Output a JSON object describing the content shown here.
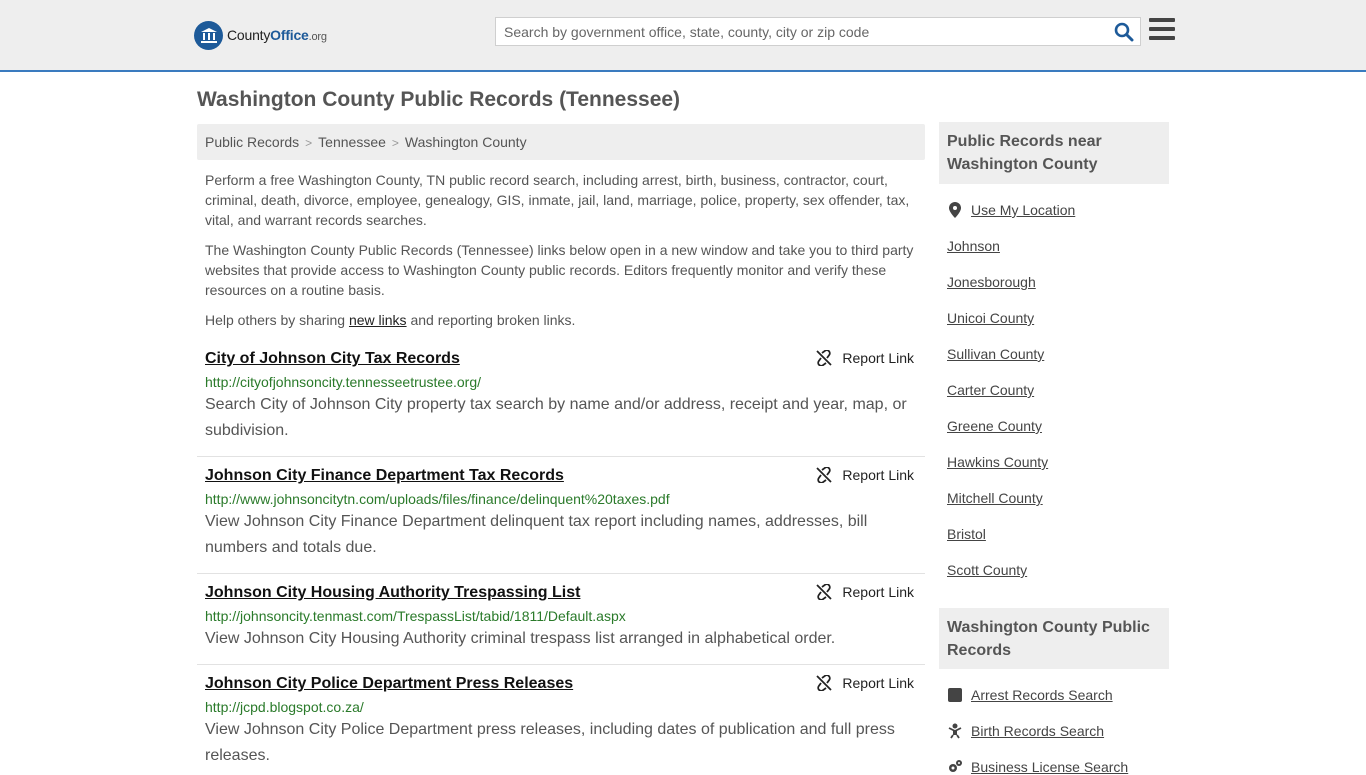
{
  "header": {
    "logo": {
      "county": "County",
      "office": "Office",
      "org": ".org"
    },
    "search_placeholder": "Search by government office, state, county, city or zip code"
  },
  "page_title": "Washington County Public Records (Tennessee)",
  "breadcrumb": [
    "Public Records",
    "Tennessee",
    "Washington County"
  ],
  "intro": {
    "p1": "Perform a free Washington County, TN public record search, including arrest, birth, business, contractor, court, criminal, death, divorce, employee, genealogy, GIS, inmate, jail, land, marriage, police, property, sex offender, tax, vital, and warrant records searches.",
    "p2": "The Washington County Public Records (Tennessee) links below open in a new window and take you to third party websites that provide access to Washington County public records. Editors frequently monitor and verify these resources on a routine basis.",
    "p3_before": "Help others by sharing ",
    "p3_link": "new links",
    "p3_after": " and reporting broken links."
  },
  "report_label": "Report Link",
  "records": [
    {
      "title": "City of Johnson City Tax Records",
      "url": "http://cityofjohnsoncity.tennesseetrustee.org/",
      "desc": "Search City of Johnson City property tax search by name and/or address, receipt and year, map, or subdivision."
    },
    {
      "title": "Johnson City Finance Department Tax Records",
      "url": "http://www.johnsoncitytn.com/uploads/files/finance/delinquent%20taxes.pdf",
      "desc": "View Johnson City Finance Department delinquent tax report including names, addresses, bill numbers and totals due."
    },
    {
      "title": "Johnson City Housing Authority Trespassing List",
      "url": "http://johnsoncity.tenmast.com/TrespassList/tabid/1811/Default.aspx",
      "desc": "View Johnson City Housing Authority criminal trespass list arranged in alphabetical order."
    },
    {
      "title": "Johnson City Police Department Press Releases",
      "url": "http://jcpd.blogspot.co.za/",
      "desc": "View Johnson City Police Department press releases, including dates of publication and full press releases."
    }
  ],
  "sidebar": {
    "nearby_title": "Public Records near Washington County",
    "use_location": "Use My Location",
    "nearby": [
      "Johnson",
      "Jonesborough",
      "Unicoi County",
      "Sullivan County",
      "Carter County",
      "Greene County",
      "Hawkins County",
      "Mitchell County",
      "Bristol",
      "Scott County"
    ],
    "records_title": "Washington County Public Records",
    "record_links": [
      {
        "label": "Arrest Records Search",
        "icon": "arrest-icon"
      },
      {
        "label": "Birth Records Search",
        "icon": "baby-icon"
      },
      {
        "label": "Business License Search",
        "icon": "gears-icon"
      }
    ]
  }
}
